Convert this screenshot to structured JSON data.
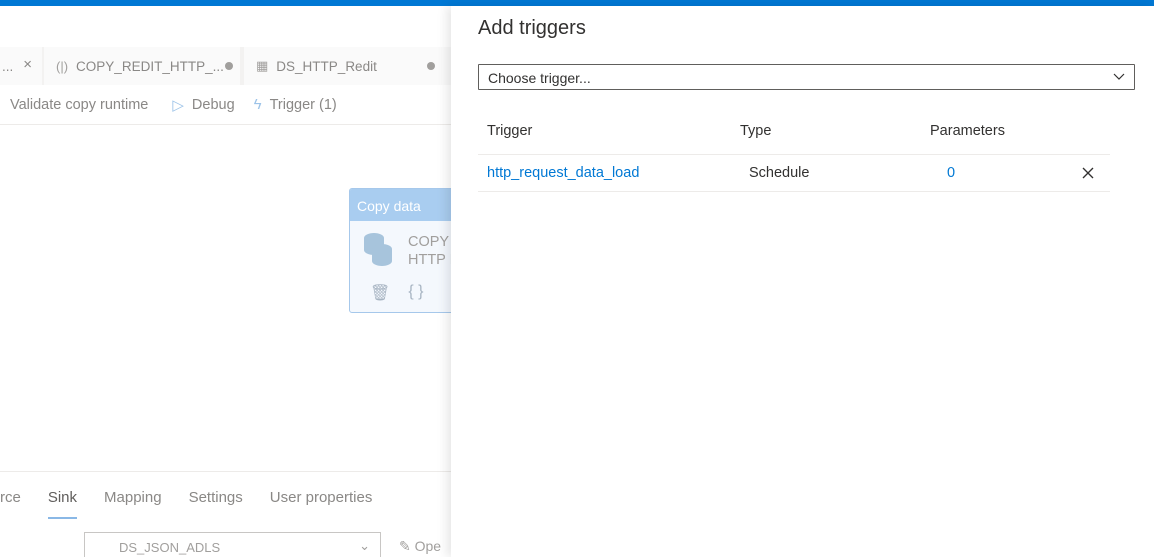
{
  "editor": {
    "tabs": [
      {
        "label": "...",
        "close": "×"
      },
      {
        "label": "COPY_REDIT_HTTP_...",
        "icon": "pipeline-icon"
      },
      {
        "label": "DS_HTTP_Redit",
        "icon": "table-icon"
      }
    ],
    "toolbar": {
      "validate_label": "Validate copy runtime",
      "debug_label": "Debug",
      "trigger_label": "Trigger (1)"
    },
    "activity": {
      "header": "Copy data",
      "name_line1": "COPY",
      "name_line2": "HTTP I",
      "actions": [
        "🗑",
        "{ }"
      ]
    },
    "bottom_tabs": [
      "rce",
      "Sink",
      "Mapping",
      "Settings",
      "User properties"
    ],
    "active_tab": "Sink",
    "dataset_value": "DS_JSON_ADLS",
    "open_label": "Ope"
  },
  "panel": {
    "title": "Add triggers",
    "trigger_select_placeholder": "Choose trigger...",
    "columns": [
      "Trigger",
      "Type",
      "Parameters"
    ],
    "rows": [
      {
        "trigger": "http_request_data_load",
        "type": "Schedule",
        "parameters": "0"
      }
    ]
  },
  "colors": {
    "accent": "#0078d4",
    "link": "#0078d4"
  }
}
